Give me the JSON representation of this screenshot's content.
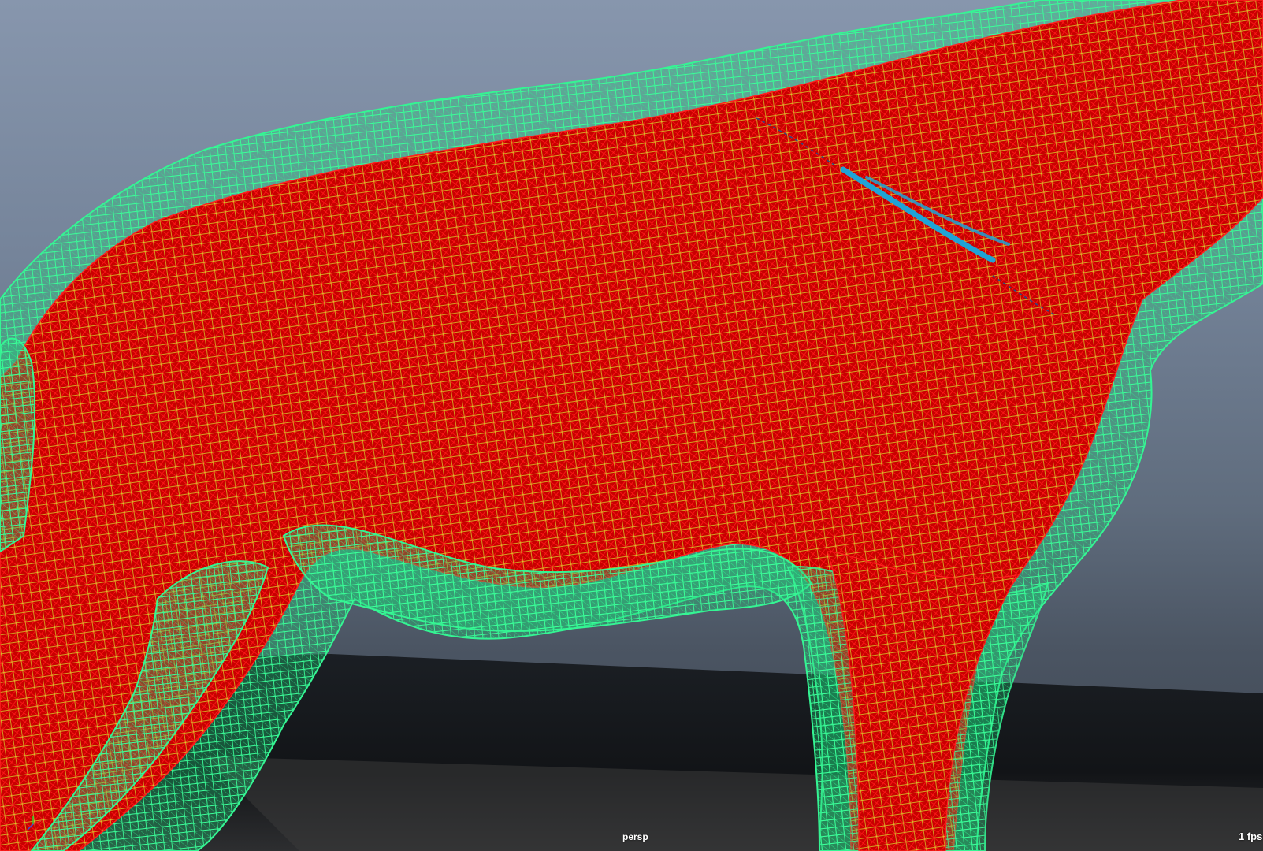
{
  "viewport": {
    "camera_name": "persp",
    "fps_readout": "1 fps",
    "colors": {
      "background_top": "#8796ad",
      "background_bottom": "#3a414b",
      "ground_dark": "#14171b",
      "ground_light": "#3d3d3d",
      "skin_wire_red": "#e60000",
      "inner_wire_yellow": "#d6d62a",
      "outer_cage_green": "#2ef08a",
      "selected_edge_blue": "#1fa3d6"
    },
    "icons": {
      "axis_gizmo": "axis-gizmo-icon"
    }
  }
}
